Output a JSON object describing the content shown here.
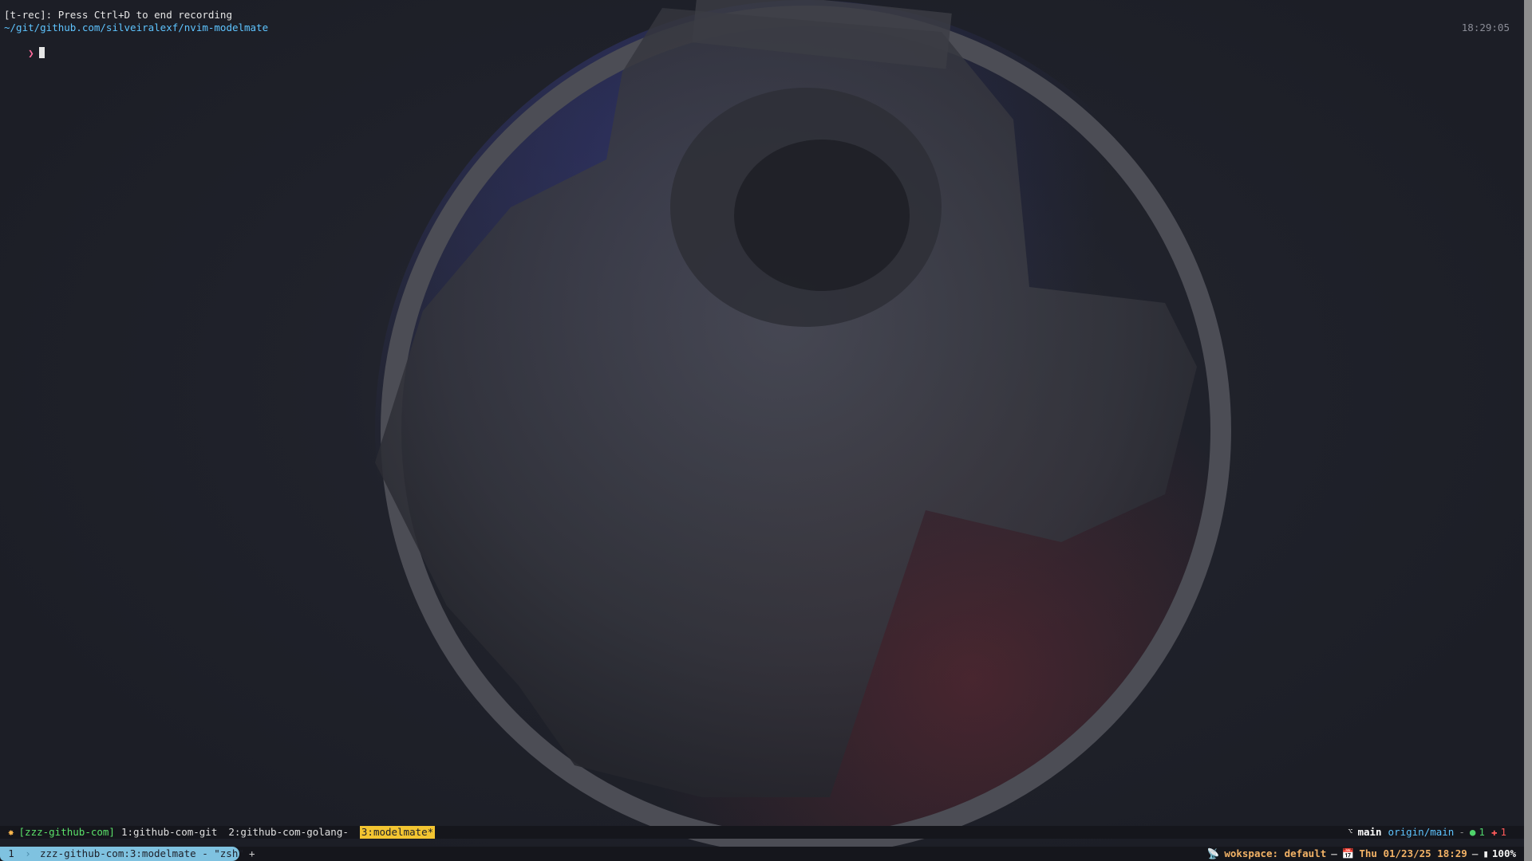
{
  "terminal": {
    "recording_notice": "[t-rec]: Press Ctrl+D to end recording",
    "cwd": "~/git/github.com/silveiralexf/nvim-modelmate",
    "prompt_symbol": "❯",
    "clock": "18:29:05"
  },
  "tmux": {
    "session_icon": "burst-icon",
    "session": "[zzz-github-com]",
    "windows": [
      {
        "label": "1:github-com-git"
      },
      {
        "label": "2:github-com-golang-"
      },
      {
        "label": "3:modelmate*",
        "active": true
      }
    ],
    "git": {
      "branch_icon": "git-branch-icon",
      "branch": "main",
      "remote": "origin/main",
      "separator": "-",
      "staged_count": "1",
      "unstaged_count": "1"
    }
  },
  "bottom_bar": {
    "tab_index": "1",
    "tab_title": "zzz-github-com:3:modelmate - \"zsh\"",
    "new_tab": "+",
    "workspace": "wokspace: default",
    "datetime": "Thu 01/23/25 18:29",
    "battery": "100%"
  },
  "colors": {
    "background": "#1d1f28",
    "path_blue": "#5ec4ff",
    "prompt_pink": "#ff6b9d",
    "active_window_yellow": "#f3c531",
    "session_green": "#5be16a",
    "tab_blue": "#7fc2e0",
    "accent_orange": "#f2b266"
  }
}
